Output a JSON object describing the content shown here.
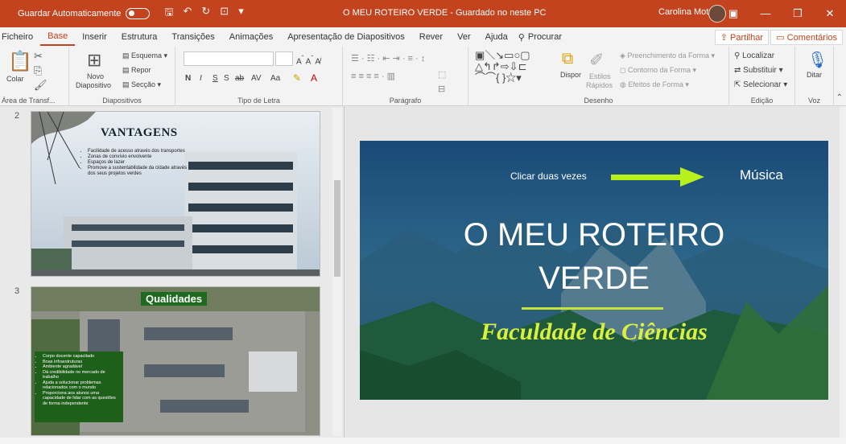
{
  "titlebar": {
    "autosave_label": "Guardar Automaticamente",
    "doc_title": "O MEU ROTEIRO VERDE - Guardado no neste PC",
    "user_name": "Carolina Mota"
  },
  "tabs": [
    "Ficheiro",
    "Base",
    "Inserir",
    "Estrutura",
    "Transições",
    "Animações",
    "Apresentação de Diapositivos",
    "Rever",
    "Ver",
    "Ajuda"
  ],
  "search_label": "Procurar",
  "share_label": "Partilhar",
  "comments_label": "Comentários",
  "ribbon": {
    "clipboard": {
      "paste": "Colar",
      "label": "Área de Transf..."
    },
    "slides": {
      "new_line1": "Novo",
      "new_line2": "Diapositivo",
      "layout": "Esquema",
      "reset": "Repor",
      "section": "Secção",
      "label": "Diapositivos"
    },
    "font": {
      "label": "Tipo de Letra",
      "bold": "N",
      "italic": "I",
      "underline": "S",
      "strike": "S",
      "spacing": "AV",
      "case": "Aa"
    },
    "paragraph": {
      "label": "Parágrafo"
    },
    "drawing": {
      "arrange": "Dispor",
      "styles_1": "Estilos",
      "styles_2": "Rápidos",
      "fill": "Preenchimento da Forma",
      "outline": "Contorno da Forma",
      "effects": "Efeitos de Forma",
      "label": "Desenho"
    },
    "editing": {
      "find": "Localizar",
      "replace": "Substituir",
      "select": "Selecionar",
      "label": "Edição"
    },
    "voice": {
      "dictate": "Ditar",
      "label": "Voz"
    }
  },
  "slides_panel": {
    "slide2": {
      "number": "2",
      "title": "Vantagens",
      "bullets": [
        "Facilidade de acesso através dos transportes",
        "Zonas de convívio envolvente",
        "Espaços de lazer",
        "Promove a sustentabilidade da cidade através dos seus projetos verdes"
      ]
    },
    "slide3": {
      "number": "3",
      "title": "Qualidades",
      "bullets": [
        "Corpo docente capacitado",
        "Boas infraestruturas",
        "Ambiente agradável",
        "Dá credibilidade no mercado de trabalho",
        "Ajuda a solucionar problemas relacionados com o mundo",
        "Proporciona aos alunos uma capacidade de lidar com as questões de forma independente"
      ]
    }
  },
  "main_slide": {
    "double_click": "Clicar duas vezes",
    "music": "Música",
    "title_line1": "O MEU ROTEIRO",
    "title_line2": "VERDE",
    "subtitle": "Faculdade de Ciências"
  }
}
